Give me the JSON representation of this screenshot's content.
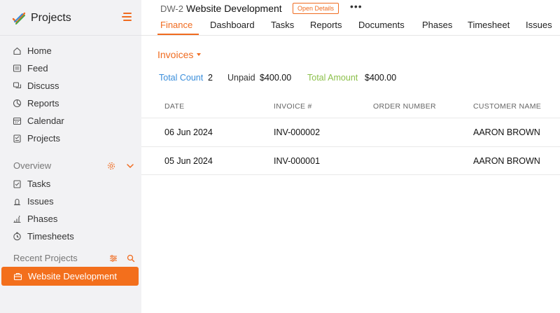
{
  "sidebar": {
    "brand": {
      "name": "Projects"
    },
    "nav": [
      {
        "label": "Home",
        "icon": "home-icon"
      },
      {
        "label": "Feed",
        "icon": "feed-icon"
      },
      {
        "label": "Discuss",
        "icon": "discuss-icon"
      },
      {
        "label": "Reports",
        "icon": "reports-icon"
      },
      {
        "label": "Calendar",
        "icon": "calendar-icon"
      },
      {
        "label": "Projects",
        "icon": "projects-icon"
      }
    ],
    "overview": {
      "title": "Overview",
      "items": [
        {
          "label": "Tasks",
          "icon": "tasks-icon"
        },
        {
          "label": "Issues",
          "icon": "issues-icon"
        },
        {
          "label": "Phases",
          "icon": "phases-icon"
        },
        {
          "label": "Timesheets",
          "icon": "timesheets-icon"
        }
      ]
    },
    "recent": {
      "title": "Recent Projects",
      "items": [
        {
          "label": "Website Development",
          "icon": "briefcase-icon",
          "active": true
        }
      ]
    }
  },
  "header": {
    "project_code": "DW-2",
    "project_title": "Website Development",
    "open_details_label": "Open Details",
    "more_label": "•••"
  },
  "tabs": [
    {
      "label": "Finance",
      "active": true
    },
    {
      "label": "Dashboard"
    },
    {
      "label": "Tasks"
    },
    {
      "label": "Reports"
    },
    {
      "label": "Documents"
    },
    {
      "label": "Phases"
    },
    {
      "label": "Timesheet"
    },
    {
      "label": "Issues"
    }
  ],
  "invoices": {
    "title": "Invoices",
    "summary": {
      "total_count_label": "Total Count",
      "total_count_value": "2",
      "unpaid_label": "Unpaid",
      "unpaid_value": "$400.00",
      "total_amount_label": "Total Amount",
      "total_amount_value": "$400.00"
    },
    "columns": [
      "DATE",
      "INVOICE #",
      "ORDER NUMBER",
      "CUSTOMER NAME"
    ],
    "rows": [
      {
        "date": "06 Jun 2024",
        "invoice": "INV-000002",
        "order": "",
        "customer": "AARON BROWN"
      },
      {
        "date": "05 Jun 2024",
        "invoice": "INV-000001",
        "order": "",
        "customer": "AARON BROWN"
      }
    ]
  },
  "colors": {
    "accent": "#f06b1f",
    "total_count_label": "#3a8edb",
    "total_amount_label": "#8cc04b",
    "sidebar_bg": "#f2f2f4"
  }
}
